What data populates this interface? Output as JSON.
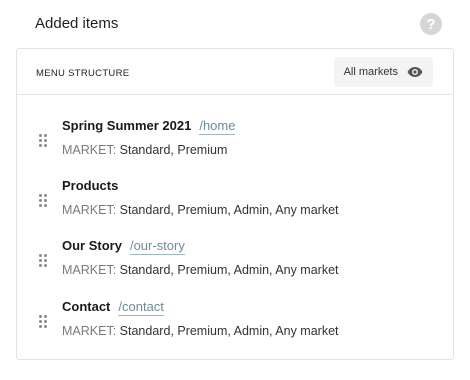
{
  "header": {
    "title": "Added items",
    "help_glyph": "?"
  },
  "panel": {
    "title": "MENU STRUCTURE",
    "market_toggle": {
      "label": "All markets",
      "icon": "eye-icon"
    }
  },
  "market_prefix": "MARKET:",
  "items": [
    {
      "title": "Spring Summer 2021",
      "path": "/home",
      "markets": "Standard, Premium"
    },
    {
      "title": "Products",
      "path": "",
      "markets": "Standard, Premium, Admin, Any market"
    },
    {
      "title": "Our Story",
      "path": "/our-story",
      "markets": "Standard, Premium, Admin, Any market"
    },
    {
      "title": "Contact",
      "path": "/contact",
      "markets": "Standard, Premium, Admin, Any market"
    }
  ],
  "colors": {
    "path_link": "#6d8d9a",
    "muted": "#7a7a7a",
    "help_icon_bg": "#d6d6d6"
  }
}
